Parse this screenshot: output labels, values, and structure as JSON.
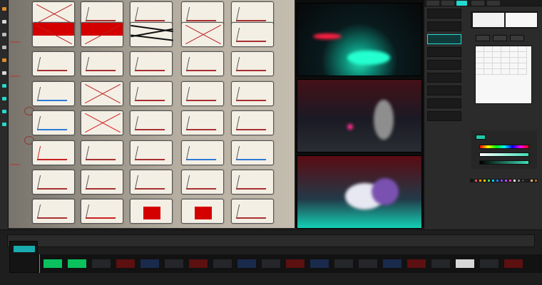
{
  "accent_color": "#24d9cf",
  "storyboard": {
    "rows": 8,
    "columns": 5
  },
  "tools": [
    {
      "name": "brush-tool",
      "color": "#e08a2a"
    },
    {
      "name": "pencil-tool",
      "color": "#d7d7d7"
    },
    {
      "name": "eraser-tool",
      "color": "#bbbbbb"
    },
    {
      "name": "selection-tool",
      "color": "#bbbbbb"
    },
    {
      "name": "fill-tool",
      "color": "#e08a2a"
    },
    {
      "name": "text-tool",
      "color": "#d7d7d7"
    },
    {
      "name": "shape-tool",
      "color": "#24d9cf"
    },
    {
      "name": "transform-tool",
      "color": "#24d9cf"
    },
    {
      "name": "zoom-tool",
      "color": "#24d9cf"
    },
    {
      "name": "hand-tool",
      "color": "#24d9cf"
    }
  ],
  "right_panel": {
    "thumb_count": 10,
    "swatch_colors": [
      "#161616",
      "#ff4f4f",
      "#ffa400",
      "#ffd200",
      "#4fd94f",
      "#00d6ff",
      "#2f80ff",
      "#7b4dff",
      "#b14cff",
      "#ff4fa3",
      "#ffffff",
      "#8c8c8c",
      "#434343",
      "#222222",
      "#f4b27a",
      "#a86d2d"
    ]
  },
  "timeline": {
    "clips": [
      "green",
      "green",
      "dark",
      "red",
      "blue",
      "dark",
      "red",
      "dark",
      "blue",
      "dark",
      "red",
      "blue",
      "dark",
      "dark",
      "blue",
      "red",
      "dark",
      "white",
      "dark",
      "red"
    ]
  }
}
